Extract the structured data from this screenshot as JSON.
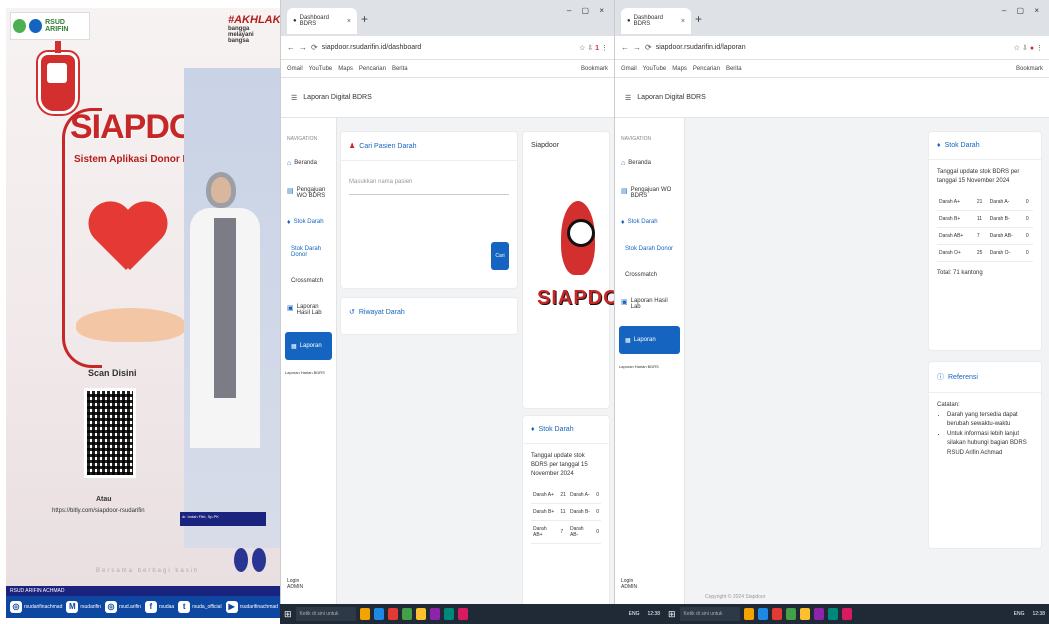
{
  "poster": {
    "logos_text": "RSUD ARIFIN",
    "tag": "#AKHLAK",
    "tag_sub": "bangga melayani bangsa",
    "title": "SIAPDOOR",
    "subtitle": "Sistem Aplikasi Donor Darah",
    "scan_label": "Scan Disini",
    "or_label": "Atau",
    "url": "https://bitly.com/siapdoor-rsudarifin",
    "name_box": "dr. Indah Fitri, Sp.PK",
    "subtext": "Bersama berbagi kasih",
    "footer_text": "RSUD ARIFIN ACHMAD",
    "social": [
      "rsudarifinachmad",
      "rsudarifin",
      "rsud.arifin",
      "rsudaa",
      "rsuda_official",
      "rsudarifinachmad"
    ]
  },
  "left_window": {
    "tab_title": "Dashboard BDRS",
    "url": "siapdoor.rsudarifin.id/dashboard",
    "ext_badge": "1",
    "bookmarks": [
      "Gmail",
      "YouTube",
      "Maps",
      "Pencarian",
      "Berita"
    ],
    "bookmark_right": "Bookmark",
    "header_title": "Laporan Digital BDRS",
    "sidebar": {
      "heading": "NAVIGATION",
      "items": [
        "Beranda",
        "Pengajuan WO BDRS",
        "Stok Darah",
        "Stok Darah Donor",
        "Crossmatch",
        "Laporan Hasil Lab"
      ],
      "active": "Laporan",
      "small": "Laporan Harian BDRS",
      "user": "Login\nADMIN"
    },
    "search_card": {
      "title": "Cari Pasien Darah",
      "placeholder": "Masukkan nama pasien",
      "button": "Cari"
    },
    "history_card": {
      "title": "Riwayat Darah"
    },
    "logo_card": {
      "title": "Siapdoor",
      "logo_text": "SIAPDOOR"
    },
    "stock_card": {
      "title": "Stok Darah",
      "desc": "Tanggal update stok BDRS per tanggal 15 November 2024",
      "rows": [
        [
          "Darah A+",
          "21",
          "Darah A-",
          "0"
        ],
        [
          "Darah B+",
          "11",
          "Darah B-",
          "0"
        ],
        [
          "Darah AB+",
          "7",
          "Darah AB-",
          "0"
        ]
      ]
    }
  },
  "right_window": {
    "tab_title": "Dashboard BDRS",
    "url": "siapdoor.rsudarifin.id/laporan",
    "bookmarks": [
      "Gmail",
      "YouTube",
      "Maps",
      "Pencarian",
      "Berita"
    ],
    "bookmark_right": "Bookmark",
    "header_title": "Laporan Digital BDRS",
    "sidebar": {
      "heading": "NAVIGATION",
      "items": [
        "Beranda",
        "Pengajuan WO BDRS",
        "Stok Darah",
        "Stok Darah Donor",
        "Crossmatch",
        "Laporan Hasil Lab"
      ],
      "active": "Laporan",
      "small": "Laporan Harian BDRS",
      "user": "Login\nADMIN"
    },
    "stock_card": {
      "title": "Stok Darah",
      "desc": "Tanggal update stok BDRS per tanggal 15 November 2024",
      "rows": [
        [
          "Darah A+",
          "21",
          "Darah A-",
          "0"
        ],
        [
          "Darah B+",
          "11",
          "Darah B-",
          "0"
        ],
        [
          "Darah AB+",
          "7",
          "Darah AB-",
          "0"
        ],
        [
          "Darah O+",
          "25",
          "Darah O-",
          "0"
        ]
      ],
      "total": "Total: 71 kantong"
    },
    "ref_card": {
      "title": "Referensi",
      "lead": "Catatan:",
      "items": [
        "Darah yang tersedia dapat berubah sewaktu-waktu",
        "Untuk informasi lebih lanjut silakan hubungi bagian BDRS RSUD Arifin Achmad"
      ]
    },
    "footer": "Copyright © 2024 Siapdoor"
  },
  "taskbar": {
    "search": "Ketik di sini untuk mencari",
    "clock_left": "12:38",
    "clock_right": "12:38",
    "sys": "ENG"
  },
  "colors": {
    "primary": "#1565c0",
    "red": "#c62828"
  }
}
